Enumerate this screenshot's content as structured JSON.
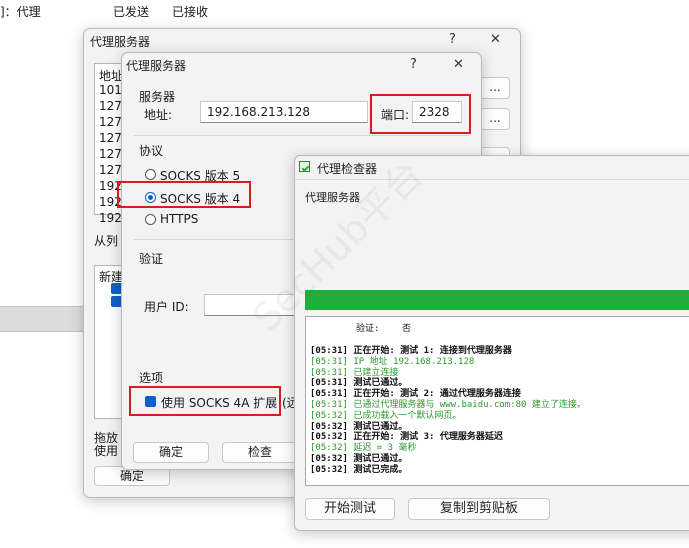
{
  "background": {
    "header_cols": [
      "]：代理",
      "已发送",
      "已接收"
    ]
  },
  "outer_dialog": {
    "title": "代理服务器",
    "help": "?",
    "close": "✕",
    "list_header": "地址",
    "list_rows": [
      "101.",
      "127.",
      "127.",
      "127.",
      "127.",
      "127.",
      "192.",
      "192.",
      "192."
    ],
    "from_list_label": "从列",
    "rules_first": "新建",
    "drag_line1": "拖放",
    "drag_line2": "使用",
    "ok_button": "确定"
  },
  "server_dialog": {
    "title": "代理服务器",
    "help": "?",
    "close": "✕",
    "server_group": "服务器",
    "address_label": "地址:",
    "address_value": "192.168.213.128",
    "port_label": "端口:",
    "port_value": "2328",
    "protocol_group": "协议",
    "protocols": [
      "SOCKS 版本 5",
      "SOCKS 版本 4",
      "HTTPS"
    ],
    "selected_protocol": "SOCKS 版本 4",
    "auth_group": "验证",
    "user_id_label": "用户 ID:",
    "options_group": "选项",
    "socks4a_label": "使用 SOCKS 4A 扩展",
    "socks4a_suffix": "(远",
    "ok_button": "确定",
    "check_button": "检查"
  },
  "checker_dialog": {
    "title": "代理检查器",
    "subtitle": "代理服务器",
    "watermark": "SecHub平台",
    "progress_fraction": 1.0,
    "auth_row_label": "验证:",
    "auth_row_value": "否",
    "log": [
      {
        "t": "[05:31] 正在开始: 测试 1: 连接到代理服务器",
        "s": "k"
      },
      {
        "t": "[05:31] IP 地址  192.168.213.128",
        "s": "g"
      },
      {
        "t": "[05:31] 已建立连接",
        "s": "g"
      },
      {
        "t": "[05:31] 测试已通过。",
        "s": "k"
      },
      {
        "t": "[05:31] 正在开始: 测试 2: 通过代理服务器连接",
        "s": "k"
      },
      {
        "t": "[05:31] 已通过代理服务器与 www.baidu.com:80 建立了连接。",
        "s": "g"
      },
      {
        "t": "[05:32] 已成功载入一个默认网页。",
        "s": "g"
      },
      {
        "t": "[05:32] 测试已通过。",
        "s": "k"
      },
      {
        "t": "[05:32] 正在开始: 测试 3: 代理服务器延迟",
        "s": "k"
      },
      {
        "t": "[05:32] 延迟 = 3 毫秒",
        "s": "g"
      },
      {
        "t": "[05:32] 测试已通过。",
        "s": "k"
      },
      {
        "t": "[05:32] 测试已完成。",
        "s": "k"
      }
    ],
    "start_button": "开始测试",
    "copy_button": "复制到剪贴板"
  },
  "colors": {
    "progress": "#1fae3a",
    "highlight": "#d02020",
    "accent": "#1060c8"
  }
}
